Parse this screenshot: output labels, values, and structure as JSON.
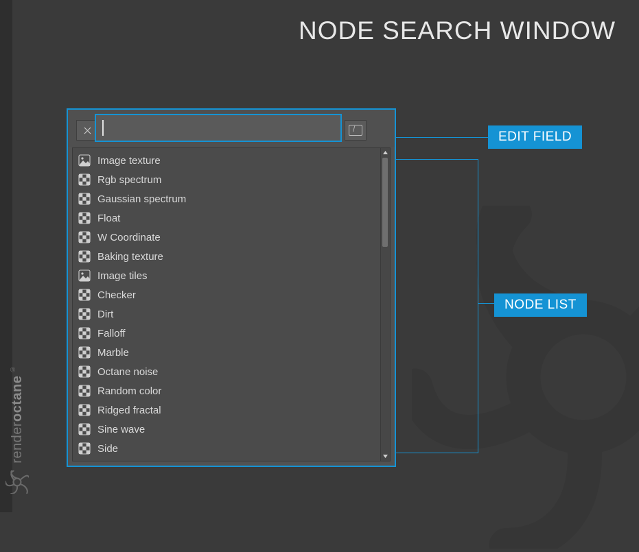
{
  "page_title": "NODE SEARCH WINDOW",
  "brand": {
    "name_light": "render",
    "name_bold": "octane",
    "reg": "®"
  },
  "callouts": {
    "edit_field": "EDIT FIELD",
    "node_list": "NODE LIST"
  },
  "search": {
    "value": "",
    "placeholder": ""
  },
  "list": {
    "items": [
      {
        "label": "Image texture",
        "icon": "image"
      },
      {
        "label": "Rgb spectrum",
        "icon": "checker"
      },
      {
        "label": "Gaussian spectrum",
        "icon": "checker"
      },
      {
        "label": "Float",
        "icon": "checker"
      },
      {
        "label": "W Coordinate",
        "icon": "checker"
      },
      {
        "label": "Baking texture",
        "icon": "checker"
      },
      {
        "label": "Image tiles",
        "icon": "image"
      },
      {
        "label": "Checker",
        "icon": "checker"
      },
      {
        "label": "Dirt",
        "icon": "checker"
      },
      {
        "label": "Falloff",
        "icon": "checker"
      },
      {
        "label": "Marble",
        "icon": "checker"
      },
      {
        "label": "Octane noise",
        "icon": "checker"
      },
      {
        "label": "Random color",
        "icon": "checker"
      },
      {
        "label": "Ridged fractal",
        "icon": "checker"
      },
      {
        "label": "Sine wave",
        "icon": "checker"
      },
      {
        "label": "Side",
        "icon": "checker"
      }
    ]
  }
}
